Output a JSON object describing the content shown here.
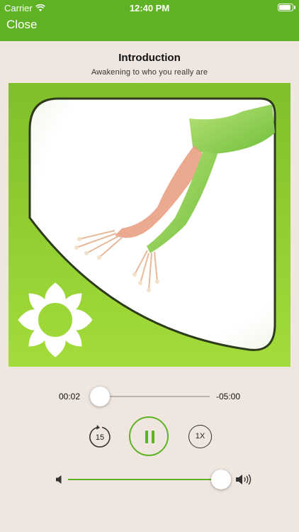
{
  "status_bar": {
    "carrier": "Carrier",
    "time": "12:40 PM"
  },
  "nav": {
    "close_label": "Close"
  },
  "track": {
    "title": "Introduction",
    "subtitle": "Awakening to who you really are"
  },
  "artwork": {
    "icon": "sacral-lotus-icon"
  },
  "playback": {
    "elapsed": "00:02",
    "remaining": "-05:00",
    "progress": 0.007
  },
  "controls": {
    "skip_back_label": "15",
    "speed_label": "1X",
    "state": "playing"
  },
  "volume": {
    "level": 0.9
  },
  "colors": {
    "accent": "#5eb224",
    "background": "#efe6e0"
  }
}
